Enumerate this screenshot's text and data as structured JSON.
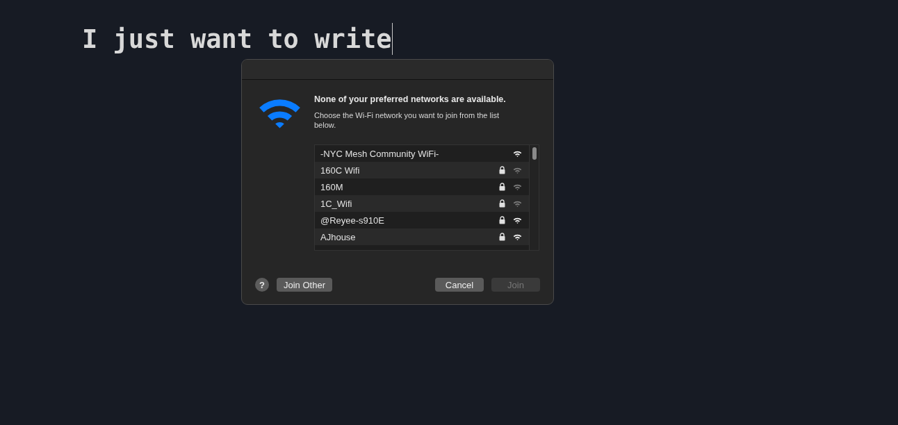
{
  "editor": {
    "text": "I just want to write"
  },
  "dialog": {
    "heading": "None of your preferred networks are available.",
    "message": "Choose the Wi-Fi network you want to join from the list below.",
    "networks": [
      {
        "name": "-NYC Mesh Community WiFi-",
        "locked": false,
        "strong": true
      },
      {
        "name": "160C Wifi",
        "locked": true,
        "strong": false
      },
      {
        "name": "160M",
        "locked": true,
        "strong": false
      },
      {
        "name": "1C_Wifi",
        "locked": true,
        "strong": false
      },
      {
        "name": "@Reyee-s910E",
        "locked": true,
        "strong": true
      },
      {
        "name": "AJhouse",
        "locked": true,
        "strong": true
      }
    ],
    "help": "?",
    "left_buttons": [
      {
        "label": "Join Other",
        "disabled": false
      }
    ],
    "right_buttons": [
      {
        "label": "Cancel",
        "disabled": false
      },
      {
        "label": "Join",
        "disabled": true
      }
    ]
  }
}
